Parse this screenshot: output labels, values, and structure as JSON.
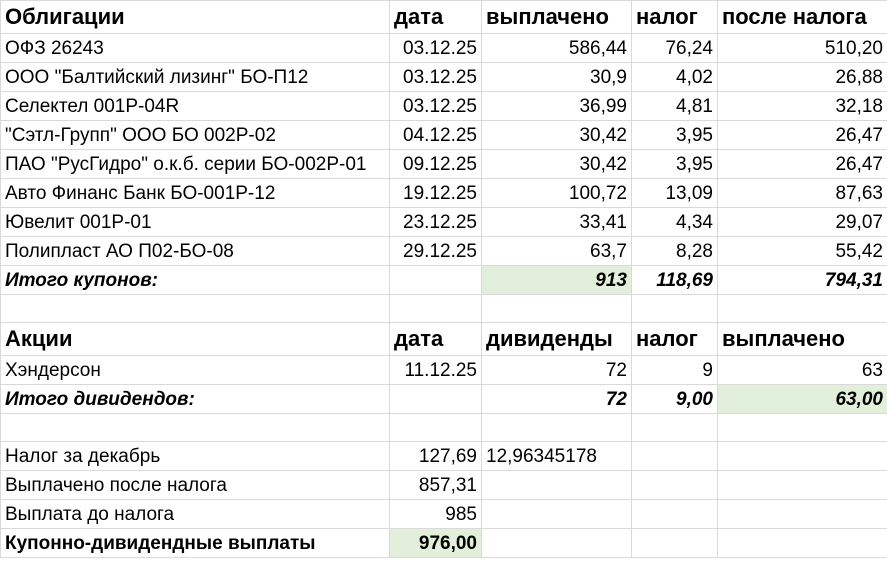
{
  "bonds": {
    "header": [
      "Облигации",
      "дата",
      "выплачено",
      "налог",
      "после налога"
    ],
    "rows": [
      [
        "ОФЗ 26243",
        "03.12.25",
        "586,44",
        "76,24",
        "510,20"
      ],
      [
        "ООО \"Балтийский лизинг\" БО-П12",
        "03.12.25",
        "30,9",
        "4,02",
        "26,88"
      ],
      [
        "Селектел 001Р-04R",
        "03.12.25",
        "36,99",
        "4,81",
        "32,18"
      ],
      [
        "\"Сэтл-Групп\" ООО БО 002Р-02",
        "04.12.25",
        "30,42",
        "3,95",
        "26,47"
      ],
      [
        "ПАО \"РусГидро\" о.к.б. серии БО-002Р-01",
        "09.12.25",
        "30,42",
        "3,95",
        "26,47"
      ],
      [
        "Авто Финанс Банк БО-001Р-12",
        "19.12.25",
        "100,72",
        "13,09",
        "87,63"
      ],
      [
        "Ювелит 001Р-01",
        "23.12.25",
        "33,41",
        "4,34",
        "29,07"
      ],
      [
        "Полипласт АО П02-БО-08",
        "29.12.25",
        "63,7",
        "8,28",
        "55,42"
      ]
    ],
    "total": [
      "Итого купонов:",
      "",
      "913",
      "118,69",
      "794,31"
    ]
  },
  "stocks": {
    "header": [
      "Акции",
      "дата",
      "дивиденды",
      "налог",
      "выплачено"
    ],
    "rows": [
      [
        "Хэндерсон",
        "11.12.25",
        "72",
        "9",
        "63"
      ]
    ],
    "total": [
      "Итого дивидендов:",
      "",
      "72",
      "9,00",
      "63,00"
    ]
  },
  "summary": {
    "tax_label": "Налог за декабрь",
    "tax_value": "127,69",
    "tax_extra": "12,96345178",
    "after_tax_label": "Выплачено после налога",
    "after_tax_value": "857,31",
    "before_tax_label": "Выплата до налога",
    "before_tax_value": "985",
    "total_label": "Купонно-дивидендные выплаты",
    "total_value": "976,00"
  },
  "colors": {
    "highlight": "#e2efda",
    "grid": "#d9d9d9"
  }
}
